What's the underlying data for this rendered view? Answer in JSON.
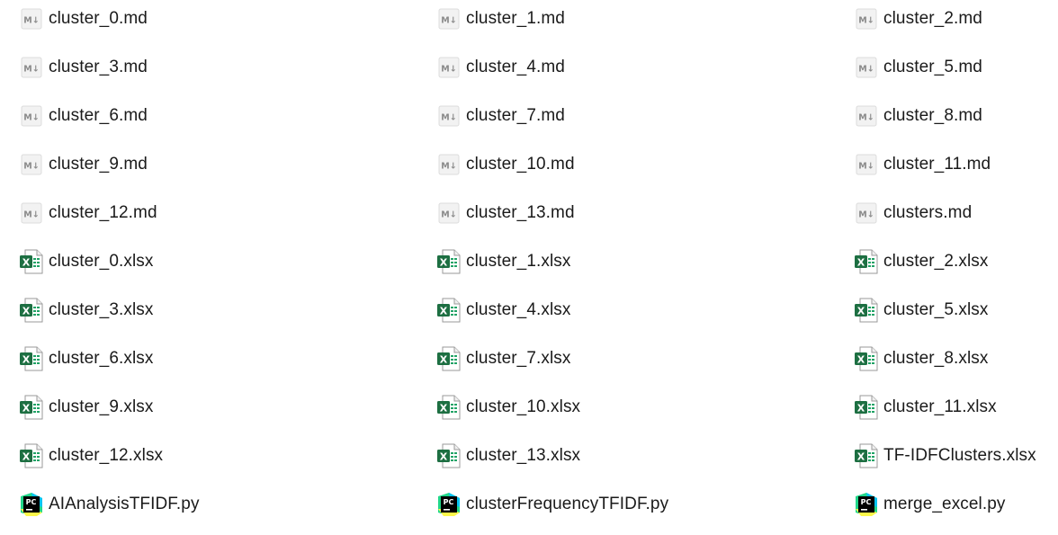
{
  "files": [
    {
      "name": "cluster_0.md",
      "type": "md"
    },
    {
      "name": "cluster_1.md",
      "type": "md"
    },
    {
      "name": "cluster_2.md",
      "type": "md"
    },
    {
      "name": "cluster_3.md",
      "type": "md"
    },
    {
      "name": "cluster_4.md",
      "type": "md"
    },
    {
      "name": "cluster_5.md",
      "type": "md"
    },
    {
      "name": "cluster_6.md",
      "type": "md"
    },
    {
      "name": "cluster_7.md",
      "type": "md"
    },
    {
      "name": "cluster_8.md",
      "type": "md"
    },
    {
      "name": "cluster_9.md",
      "type": "md"
    },
    {
      "name": "cluster_10.md",
      "type": "md"
    },
    {
      "name": "cluster_11.md",
      "type": "md"
    },
    {
      "name": "cluster_12.md",
      "type": "md"
    },
    {
      "name": "cluster_13.md",
      "type": "md"
    },
    {
      "name": "clusters.md",
      "type": "md"
    },
    {
      "name": "cluster_0.xlsx",
      "type": "xlsx"
    },
    {
      "name": "cluster_1.xlsx",
      "type": "xlsx"
    },
    {
      "name": "cluster_2.xlsx",
      "type": "xlsx"
    },
    {
      "name": "cluster_3.xlsx",
      "type": "xlsx"
    },
    {
      "name": "cluster_4.xlsx",
      "type": "xlsx"
    },
    {
      "name": "cluster_5.xlsx",
      "type": "xlsx"
    },
    {
      "name": "cluster_6.xlsx",
      "type": "xlsx"
    },
    {
      "name": "cluster_7.xlsx",
      "type": "xlsx"
    },
    {
      "name": "cluster_8.xlsx",
      "type": "xlsx"
    },
    {
      "name": "cluster_9.xlsx",
      "type": "xlsx"
    },
    {
      "name": "cluster_10.xlsx",
      "type": "xlsx"
    },
    {
      "name": "cluster_11.xlsx",
      "type": "xlsx"
    },
    {
      "name": "cluster_12.xlsx",
      "type": "xlsx"
    },
    {
      "name": "cluster_13.xlsx",
      "type": "xlsx"
    },
    {
      "name": "TF-IDFClusters.xlsx",
      "type": "xlsx"
    },
    {
      "name": "AIAnalysisTFIDF.py",
      "type": "py"
    },
    {
      "name": "clusterFrequencyTFIDF.py",
      "type": "py"
    },
    {
      "name": "merge_excel.py",
      "type": "py"
    }
  ],
  "icons": {
    "md": {
      "name": "markdown-file-icon",
      "glyph": "M↓",
      "bg": "#f2f2f2",
      "fg": "#8a8a8a"
    },
    "xlsx": {
      "name": "excel-file-icon",
      "badge": "X",
      "badge_color": "#1d6f42",
      "accent": "#21a366"
    },
    "py": {
      "name": "pycharm-file-icon",
      "badge": "PC",
      "colors": [
        "#21d789",
        "#fcf84a",
        "#07c3f2",
        "#000000"
      ]
    }
  }
}
